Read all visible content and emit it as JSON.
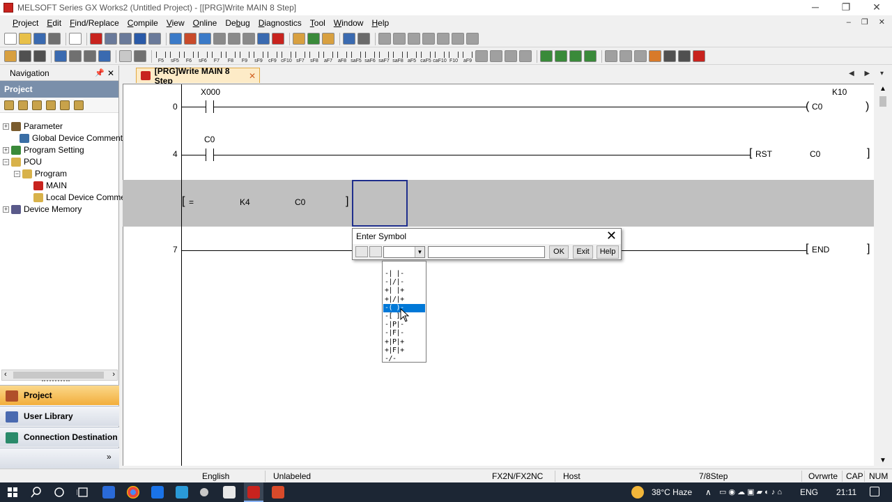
{
  "window": {
    "title": "MELSOFT Series GX Works2 (Untitled Project) - [[PRG]Write MAIN 8 Step]",
    "controls": {
      "minimize": "─",
      "restore": "❐",
      "close": "✕"
    }
  },
  "menubar": {
    "items": [
      {
        "pre": "",
        "u": "P",
        "post": "roject"
      },
      {
        "pre": "",
        "u": "E",
        "post": "dit"
      },
      {
        "pre": "",
        "u": "F",
        "post": "ind/Replace"
      },
      {
        "pre": "",
        "u": "C",
        "post": "ompile"
      },
      {
        "pre": "",
        "u": "V",
        "post": "iew"
      },
      {
        "pre": "",
        "u": "O",
        "post": "nline"
      },
      {
        "pre": "De",
        "u": "b",
        "post": "ug"
      },
      {
        "pre": "",
        "u": "D",
        "post": "iagnostics"
      },
      {
        "pre": "",
        "u": "T",
        "post": "ool"
      },
      {
        "pre": "",
        "u": "W",
        "post": "indow"
      },
      {
        "pre": "",
        "u": "H",
        "post": "elp"
      }
    ],
    "mdi_controls": "– ❐ ✕"
  },
  "ladder_toolbar": {
    "keys": [
      "F5",
      "sF5",
      "F6",
      "sF6",
      "F7",
      "F8",
      "F9",
      "sF9",
      "cF9",
      "cF10",
      "sF7",
      "sF8",
      "aF7",
      "aF8",
      "saF5",
      "saF6",
      "saF7",
      "saF8",
      "aF5",
      "caF5",
      "caF10",
      "F10",
      "aF9"
    ]
  },
  "navigation": {
    "title": "Navigation",
    "pin": "📌",
    "close": "✕",
    "section": "Project",
    "tree": [
      {
        "label": "Parameter",
        "exp": "+",
        "icon_color": "#7a5c2e"
      },
      {
        "label": "Global Device Comment",
        "exp": "",
        "icon_color": "#3a6ea5"
      },
      {
        "label": "Program Setting",
        "exp": "+",
        "icon_color": "#3a8a3a"
      },
      {
        "label": "POU",
        "exp": "−",
        "icon_color": "#d8b24a"
      },
      {
        "label": "Program",
        "exp": "−",
        "icon_color": "#d8b24a"
      },
      {
        "label": "MAIN",
        "exp": "",
        "icon_color": "#c8231e"
      },
      {
        "label": "Local Device Commen",
        "exp": "",
        "icon_color": "#d8b24a"
      },
      {
        "label": "Device Memory",
        "exp": "+",
        "icon_color": "#5a5a8a"
      }
    ],
    "scroll_left": "‹",
    "scroll_right": "›",
    "tabs": [
      {
        "label": "Project",
        "icon_color": "#b0502a"
      },
      {
        "label": "User Library",
        "icon_color": "#4a6ab0"
      },
      {
        "label": "Connection Destination",
        "icon_color": "#2a8a6a"
      }
    ],
    "more": "»"
  },
  "document_tab": {
    "label": "[PRG]Write MAIN 8 Step",
    "close": "✕",
    "nav": "◀ ▶ ▾"
  },
  "ladder": {
    "rungs": [
      {
        "step": "0",
        "contact": "X000",
        "coil": "C0",
        "constant": "K10"
      },
      {
        "step": "4",
        "contact": "C0",
        "instruction": "RST",
        "operand": "C0"
      },
      {
        "compare_op": "=",
        "operand1": "K4",
        "operand2": "C0"
      },
      {
        "step": "7",
        "instruction": "END"
      }
    ]
  },
  "enter_symbol_dialog": {
    "title": "Enter Symbol",
    "close": "✕",
    "combo_value": "",
    "combo_arrow": "▼",
    "input_value": "",
    "ok": "OK",
    "exit": "Exit",
    "help": "Help",
    "dropdown_items": [
      "-| |-",
      "-|/|-",
      "+| |+",
      "+|/|+",
      "-( )-",
      "-[ ]-",
      "-|P|-",
      "-|F|-",
      "+|P|+",
      "+|F|+",
      "-/-"
    ],
    "selected_index": 4
  },
  "statusbar": {
    "language": "English",
    "label_state": "Unlabeled",
    "cpu": "FX2N/FX2NC",
    "connection": "Host",
    "steps": "7/8Step",
    "mode": "Ovrwrte",
    "caps": "CAP",
    "num": "NUM"
  },
  "taskbar": {
    "weather": "38°C  Haze",
    "lang": "ENG",
    "time": "21:11",
    "chevron": "∧"
  }
}
